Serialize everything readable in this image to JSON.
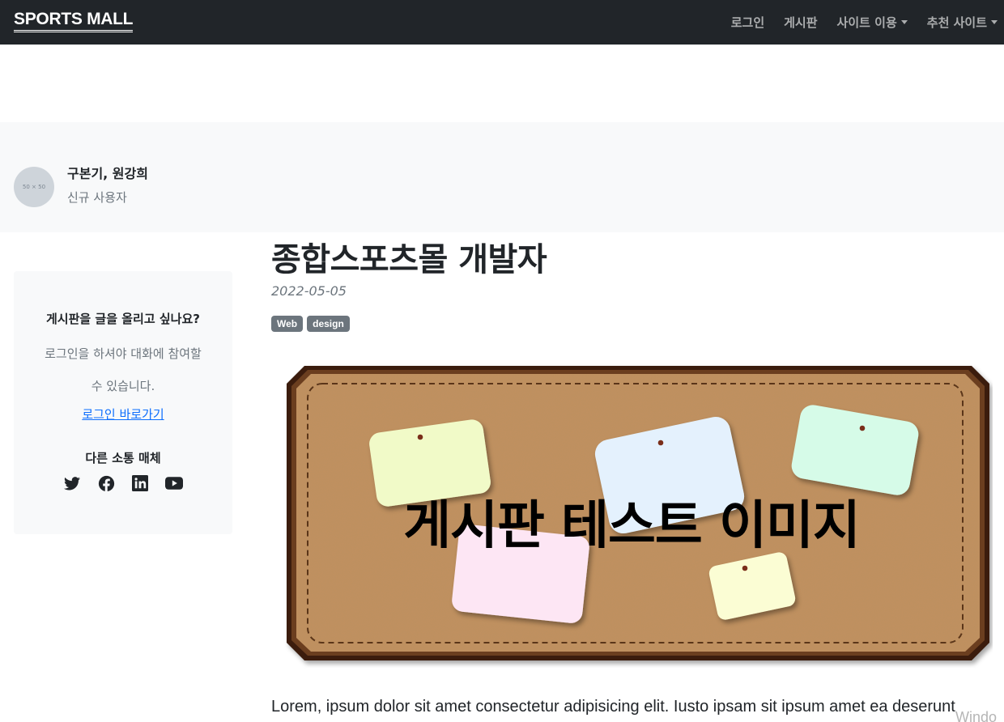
{
  "navbar": {
    "brand": "SPORTS MALL",
    "items": [
      {
        "label": "로그인",
        "dropdown": false
      },
      {
        "label": "게시판",
        "dropdown": false
      },
      {
        "label": "사이트 이용",
        "dropdown": true
      },
      {
        "label": "추천 사이트",
        "dropdown": true
      }
    ]
  },
  "author": {
    "avatar_placeholder": "50 × 50",
    "name": "구본기, 원강희",
    "role": "신규 사용자"
  },
  "sidebar": {
    "title": "게시판을 글을 올리고 싶나요?",
    "text": "로그인을 하셔야 대화에 참여할 수 있습니다.",
    "link": "로그인 바로가기",
    "social_title": "다른 소통 매체",
    "social_icons": [
      "twitter-icon",
      "facebook-icon",
      "linkedin-icon",
      "youtube-icon"
    ]
  },
  "post": {
    "title": "종합스포츠몰 개발자",
    "date": "2022-05-05",
    "tags": [
      "Web",
      "design"
    ],
    "image_caption": "게시판 테스트 이미지",
    "body": "Lorem, ipsum dolor sit amet consectetur adipisicing elit. Iusto ipsam sit ipsum amet ea deserunt"
  },
  "watermark": "Windo",
  "colors": {
    "navbar_bg": "#212529",
    "panel_bg": "#f8f9fa",
    "badge_bg": "#6c757d",
    "link": "#0d6efd",
    "cork": "#c2905f",
    "frame": "#4a2a14"
  }
}
